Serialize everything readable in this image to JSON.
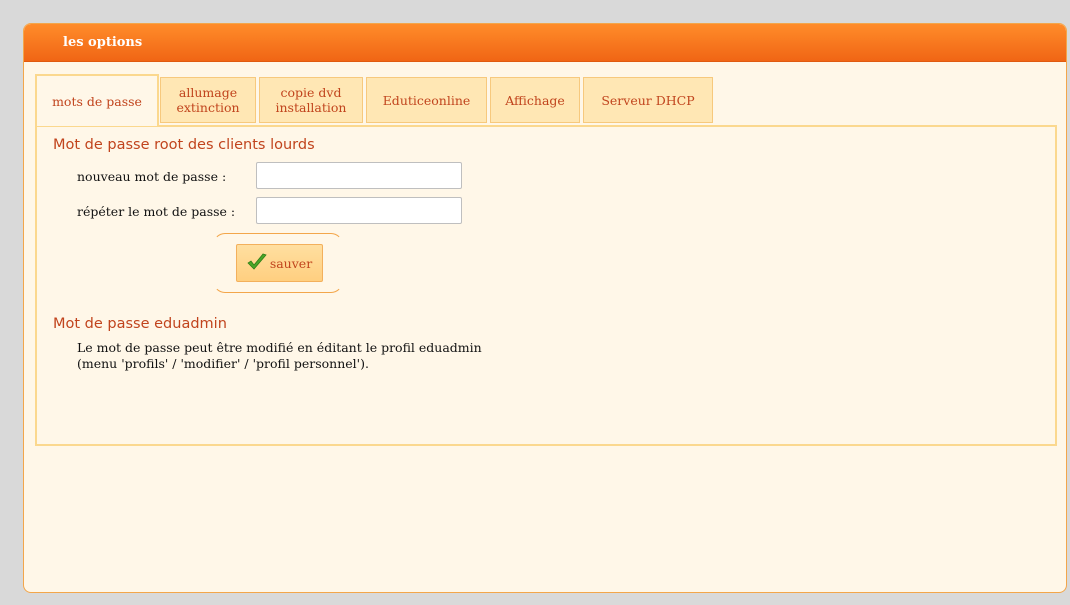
{
  "panel": {
    "title": "les options"
  },
  "tabs": [
    {
      "label": "mots de passe",
      "active": true
    },
    {
      "label": "allumage extinction",
      "active": false
    },
    {
      "label": "copie dvd installation",
      "active": false
    },
    {
      "label": "Eduticeonline",
      "active": false
    },
    {
      "label": "Affichage",
      "active": false
    },
    {
      "label": "Serveur DHCP",
      "active": false
    }
  ],
  "root_section": {
    "title": "Mot de passe root des clients lourds",
    "new_password_label": "nouveau mot de passe :",
    "new_password_value": "",
    "repeat_password_label": "répéter le mot de passe :",
    "repeat_password_value": "",
    "save_label": "sauver",
    "save_icon": "checkmark-icon"
  },
  "eduadmin_section": {
    "title": "Mot de passe eduadmin",
    "text": "Le mot de passe peut être modifié en éditant le profil eduadmin (menu 'profils' / 'modifier' / 'profil personnel')."
  },
  "colors": {
    "header": "#f06414",
    "accent_text": "#c1441d",
    "tab_bg": "#ffe7b4",
    "panel_bg": "#fff7e8"
  }
}
